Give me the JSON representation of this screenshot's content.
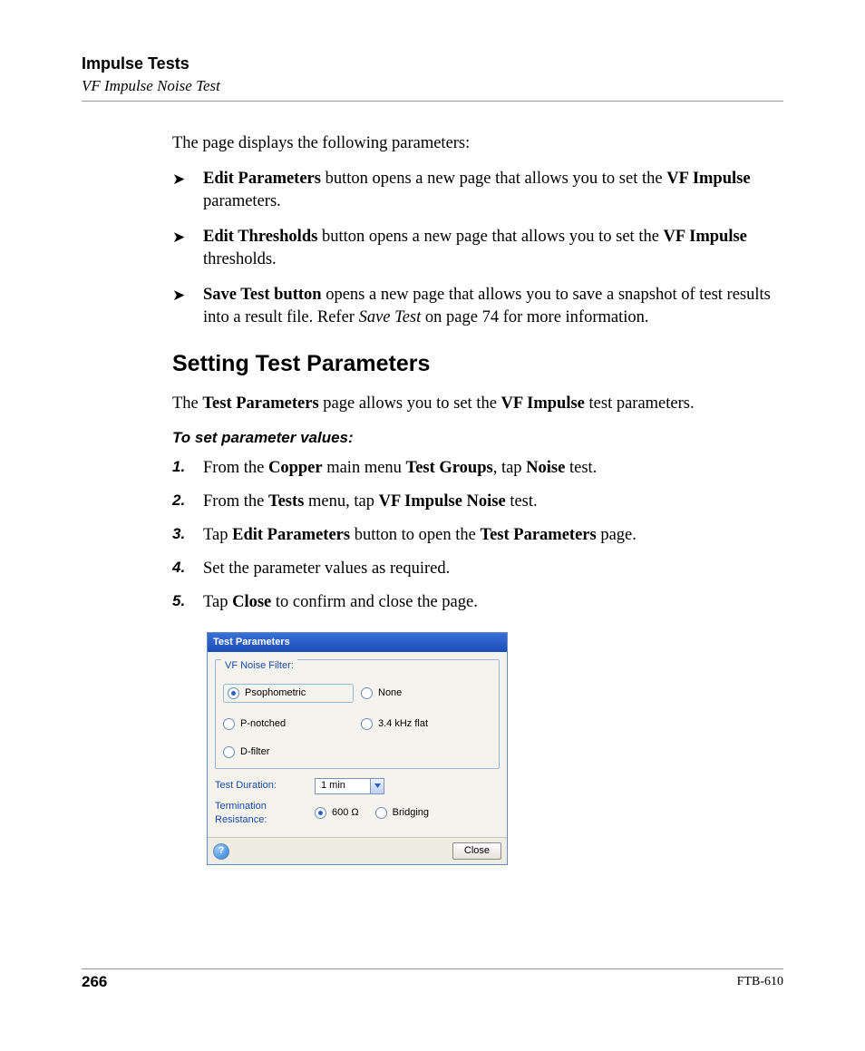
{
  "header": {
    "chapter": "Impulse Tests",
    "section": "VF Impulse Noise Test"
  },
  "intro": "The page displays the following parameters:",
  "bullets": [
    {
      "html": "<b>Edit Parameters</b> button opens a new page that allows you to set the <b>VF Impulse</b> parameters."
    },
    {
      "html": "<b>Edit Thresholds</b> button opens a new page that allows you to set the <b>VF Impulse</b> thresholds."
    },
    {
      "html": "<b>Save Test button</b> opens a new page that allows you to save a snapshot of test results into a result file. Refer <i>Save Test</i> on page 74 for more information."
    }
  ],
  "subhead": "Setting Test Parameters",
  "subintro": {
    "html": "The <b>Test Parameters</b> page allows you to set the <b>VF Impulse</b> test parameters."
  },
  "task_lead": "To set parameter values:",
  "steps": [
    {
      "html": "From the <b>Copper</b> main menu <b>Test Groups</b>, tap <b>Noise</b> test."
    },
    {
      "html": "From the <b>Tests</b> menu, tap <b>VF Impulse Noise</b> test."
    },
    {
      "html": "Tap <b>Edit Parameters</b> button to open the <b>Test Parameters</b> page."
    },
    {
      "html": "Set the parameter values as required."
    },
    {
      "html": "Tap <b>Close</b> to confirm and close the page."
    }
  ],
  "dialog": {
    "title": "Test Parameters",
    "filter": {
      "legend": "VF Noise Filter:",
      "options": [
        {
          "label": "Psophometric",
          "selected": true
        },
        {
          "label": "None",
          "selected": false
        },
        {
          "label": "P-notched",
          "selected": false
        },
        {
          "label": "3.4 kHz flat",
          "selected": false
        },
        {
          "label": "D-filter",
          "selected": false
        }
      ]
    },
    "duration": {
      "label": "Test Duration:",
      "value": "1 min"
    },
    "termination": {
      "label": "Termination Resistance:",
      "options": [
        {
          "label": "600 Ω",
          "selected": true
        },
        {
          "label": "Bridging",
          "selected": false
        }
      ]
    },
    "help": "?",
    "close": "Close"
  },
  "footer": {
    "page": "266",
    "docid": "FTB-610"
  }
}
